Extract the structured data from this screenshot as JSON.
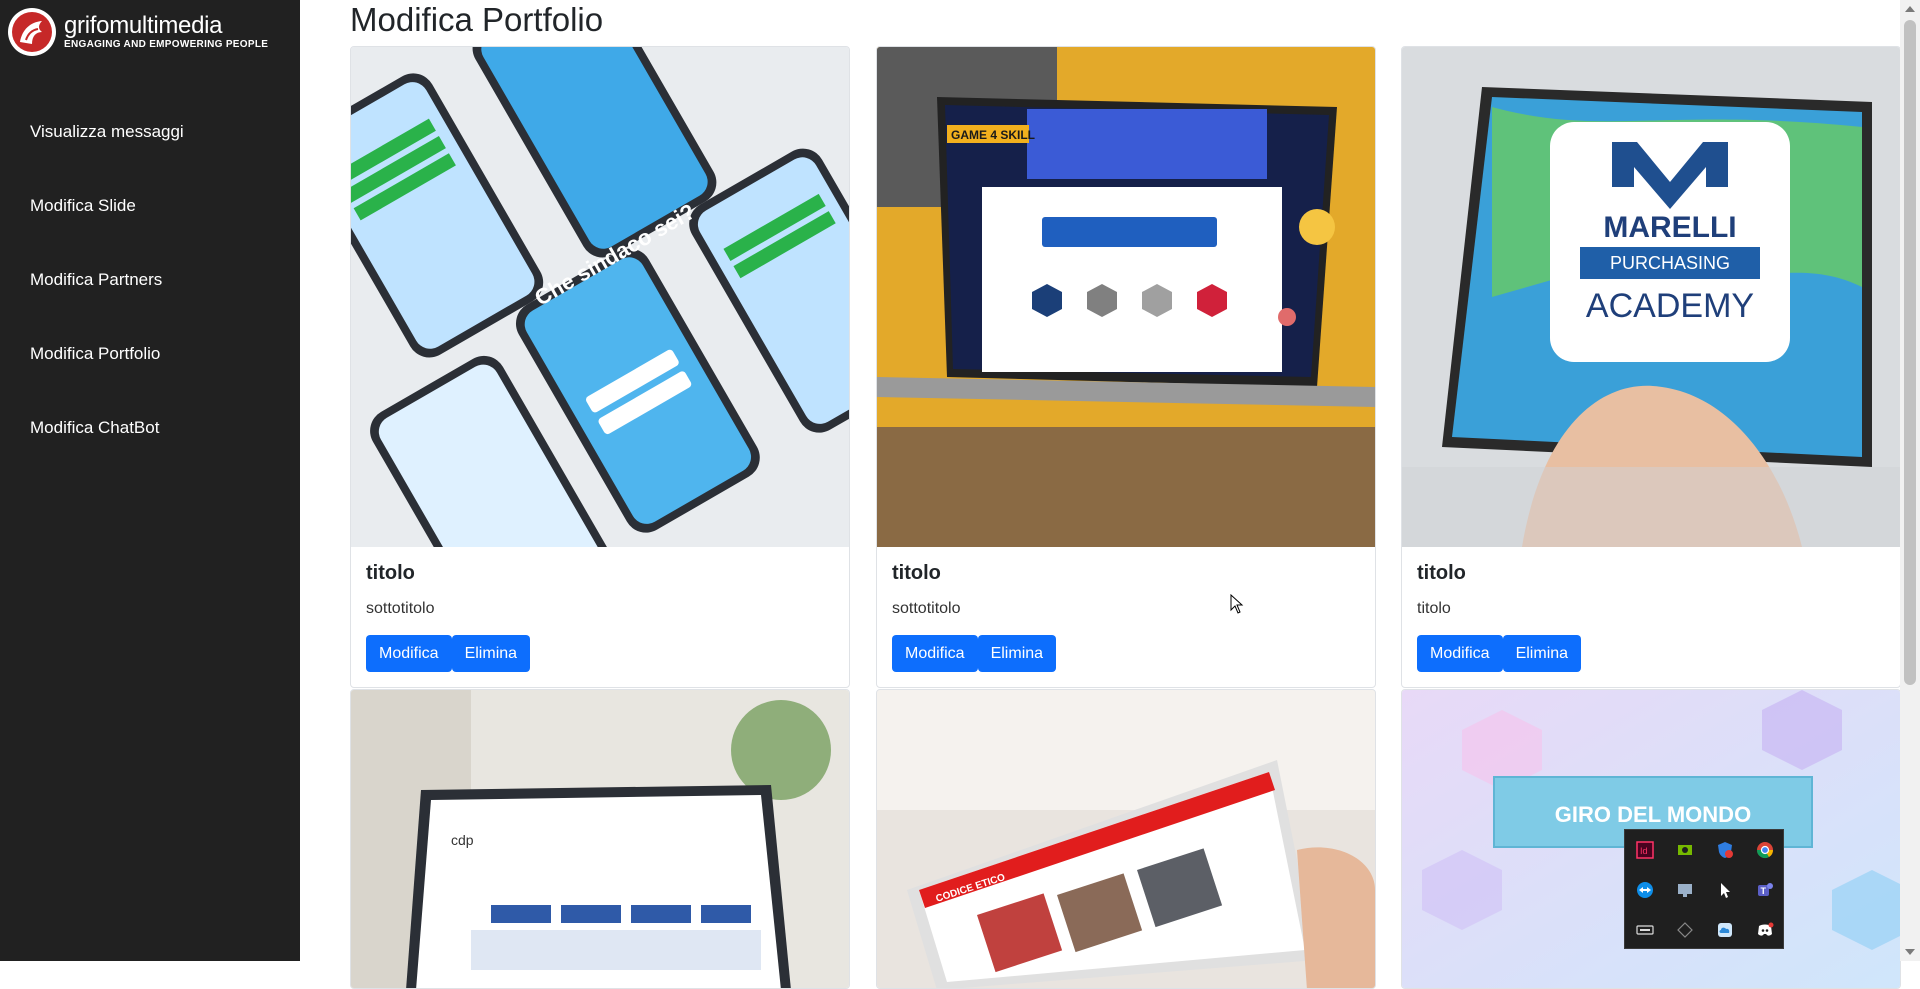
{
  "brand": {
    "name": "grifomultimedia",
    "tagline": "ENGAGING AND EMPOWERING PEOPLE"
  },
  "sidebar": {
    "items": [
      {
        "label": "Visualizza messaggi"
      },
      {
        "label": "Modifica Slide"
      },
      {
        "label": "Modifica Partners"
      },
      {
        "label": "Modifica Portfolio"
      },
      {
        "label": "Modifica ChatBot"
      }
    ]
  },
  "page": {
    "title": "Modifica Portfolio"
  },
  "portfolio": {
    "cards": [
      {
        "title": "titolo",
        "subtitle": "sottotitolo",
        "edit_label": "Modifica",
        "delete_label": "Elimina",
        "image": "phones-quiz-app"
      },
      {
        "title": "titolo",
        "subtitle": "sottotitolo",
        "edit_label": "Modifica",
        "delete_label": "Elimina",
        "image": "laptop-game4skill"
      },
      {
        "title": "titolo",
        "subtitle": "titolo",
        "edit_label": "Modifica",
        "delete_label": "Elimina",
        "image": "laptop-marelli-academy"
      },
      {
        "image": "laptop-cdp-document"
      },
      {
        "image": "tablet-codice-etico"
      },
      {
        "image": "giro-del-mondo"
      }
    ],
    "image_texts": {
      "marelli_line1": "MARELLI",
      "marelli_line2": "PURCHASING",
      "marelli_line3": "ACADEMY",
      "giro": "GIRO DEL MONDO",
      "game": "GAME 4 SKILL",
      "quiz": "Che sindaco sei?",
      "cdp": "cdp",
      "codice": "CODICE ETICO"
    }
  },
  "tray": {
    "icons": [
      "indesign-icon",
      "nvidia-icon",
      "shield-x-icon",
      "chrome-icon",
      "teamviewer-icon",
      "display-icon",
      "cursor-icon",
      "teams-icon",
      "keyboard-icon",
      "diamond-icon",
      "cloud-icon",
      "discord-icon"
    ]
  },
  "colors": {
    "sidebar_bg": "#212121",
    "primary": "#0d6efd",
    "brand_red": "#c62828"
  }
}
